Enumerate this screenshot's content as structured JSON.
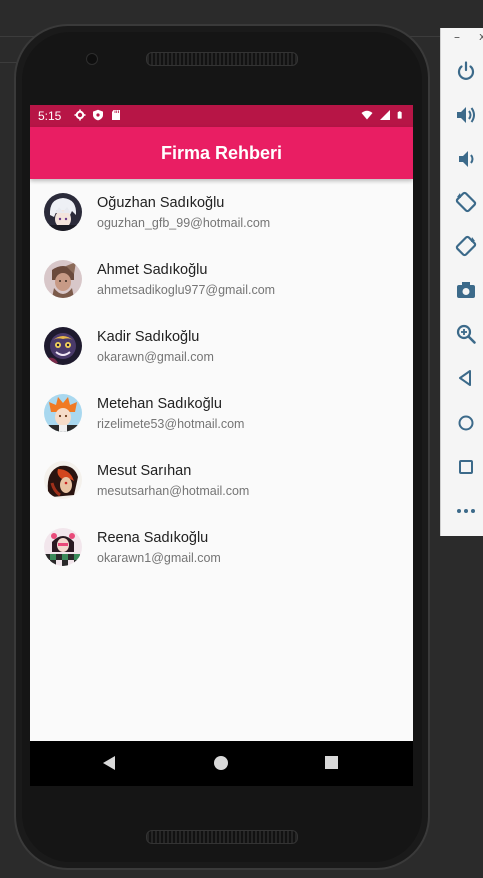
{
  "status_bar": {
    "time": "5:15"
  },
  "app_bar": {
    "title": "Firma Rehberi"
  },
  "contacts": [
    {
      "name": "Oğuzhan Sadıkoğlu",
      "email": "oguzhan_gfb_99@hotmail.com",
      "avatar": "avatar-white-hair"
    },
    {
      "name": "Ahmet Sadıkoğlu",
      "email": "ahmetsadikoglu977@gmail.com",
      "avatar": "avatar-brown-character"
    },
    {
      "name": "Kadir Sadıkoğlu",
      "email": "okarawn@gmail.com",
      "avatar": "avatar-dark-purple"
    },
    {
      "name": "Metehan Sadıkoğlu",
      "email": "rizelimete53@hotmail.com",
      "avatar": "avatar-orange-hair"
    },
    {
      "name": "Mesut Sarıhan",
      "email": "mesutsarhan@hotmail.com",
      "avatar": "avatar-red-dark"
    },
    {
      "name": "Reena Sadıkoğlu",
      "email": "okarawn1@gmail.com",
      "avatar": "avatar-pink-checker"
    }
  ],
  "navigation": {
    "back": "back-icon",
    "home": "home-icon",
    "recents": "recents-icon"
  },
  "emulator_toolbar": {
    "minimize_label": "–",
    "close_label": "x",
    "buttons": [
      "power-icon",
      "volume-up-icon",
      "volume-down-icon",
      "rotate-left-icon",
      "rotate-right-icon",
      "camera-icon",
      "zoom-icon",
      "back-icon",
      "home-icon",
      "overview-icon",
      "more-icon"
    ]
  },
  "colors": {
    "status_bar": "#b71546",
    "app_bar": "#e91e63",
    "background": "#fafafa",
    "name_text": "#212121",
    "email_text": "#757575"
  }
}
